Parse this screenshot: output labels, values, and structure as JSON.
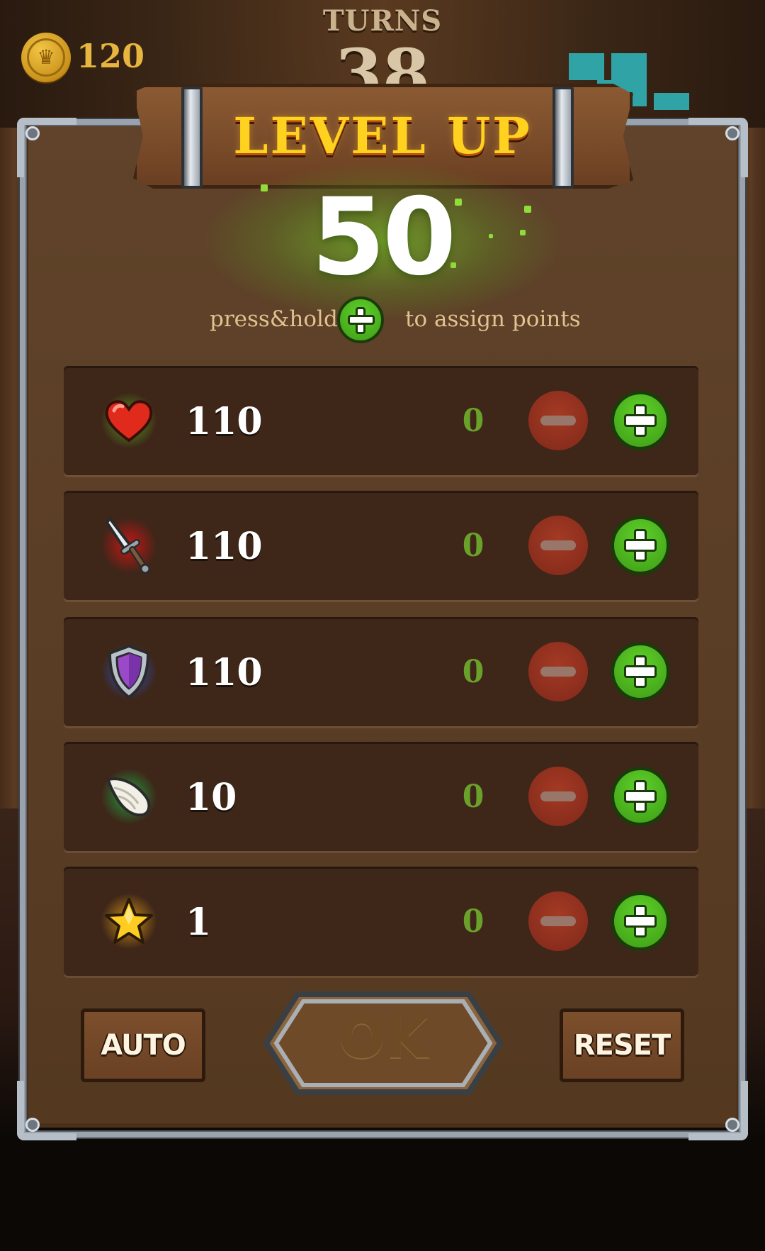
{
  "hud": {
    "coins": "120",
    "turns_label": "TURNS",
    "turns_value": "38"
  },
  "dialog": {
    "title": "LEVEL UP",
    "points_available": "50",
    "hint_before": "press&hold",
    "hint_after": "to assign points"
  },
  "stats": [
    {
      "icon": "heart-icon",
      "value": "110",
      "allocated": "0",
      "glow": "#4cc21c"
    },
    {
      "icon": "sword-icon",
      "value": "110",
      "allocated": "0",
      "glow": "#d11a1a"
    },
    {
      "icon": "shield-icon",
      "value": "110",
      "allocated": "0",
      "glow": "#2a5cd8"
    },
    {
      "icon": "wing-icon",
      "value": "10",
      "allocated": "0",
      "glow": "#1fb54a"
    },
    {
      "icon": "star-icon",
      "value": "1",
      "allocated": "0",
      "glow": "#e0a010"
    }
  ],
  "buttons": {
    "auto": "AUTO",
    "ok": "OK",
    "reset": "RESET"
  },
  "colors": {
    "title": "#ffd21f",
    "plus": "#4fb81f",
    "minus": "#8f2f1e",
    "allocated": "#6aa12a"
  }
}
